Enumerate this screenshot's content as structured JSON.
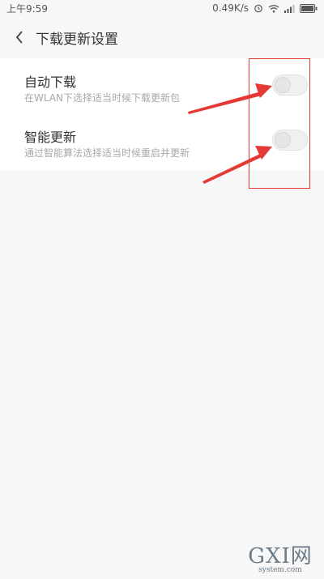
{
  "status": {
    "time": "上午9:59",
    "speed": "0.49K/s",
    "battery_icon": "battery-icon",
    "wifi_icon": "wifi-icon",
    "signal_icon": "signal-icon",
    "alarm_icon": "alarm-icon"
  },
  "header": {
    "title": "下载更新设置",
    "back_icon": "back-chevron-icon"
  },
  "settings": [
    {
      "title": "自动下载",
      "subtitle": "在WLAN下选择适当时候下载更新包",
      "enabled": false
    },
    {
      "title": "智能更新",
      "subtitle": "通过智能算法选择适当时候重启并更新",
      "enabled": false
    }
  ],
  "annotation": {
    "arrow_color": "#e53935",
    "box_color": "#e53935"
  },
  "watermark": {
    "brand": "GXI网",
    "site": "system.com"
  }
}
